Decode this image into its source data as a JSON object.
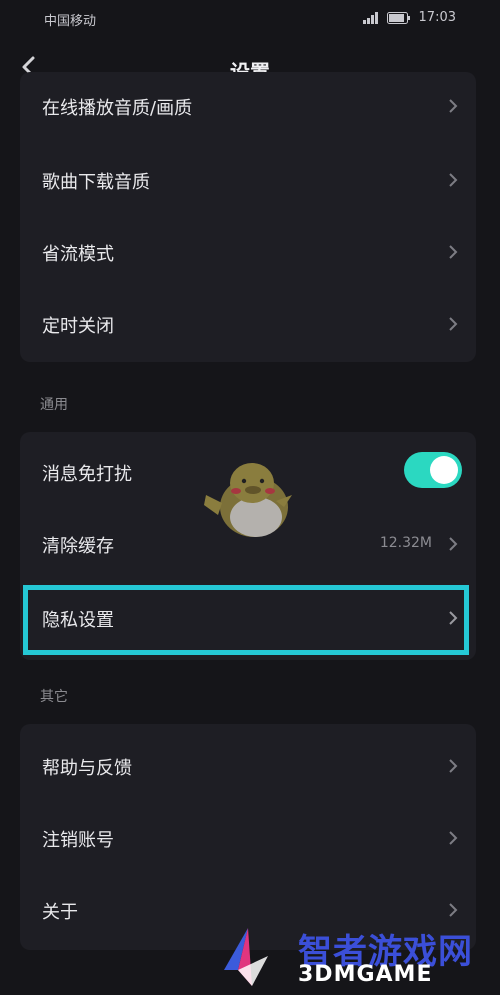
{
  "status_bar": {
    "carrier": "中国移动",
    "time": "17:03",
    "icons": [
      "signal-icon",
      "wifi-icon",
      "battery-icon"
    ]
  },
  "nav": {
    "title": "设置",
    "back_icon": "chevron-left-icon"
  },
  "sections": {
    "playback": {
      "items": [
        {
          "label": "在线播放音质/画质"
        },
        {
          "label": "歌曲下载音质"
        },
        {
          "label": "省流模式"
        },
        {
          "label": "定时关闭"
        }
      ]
    },
    "general": {
      "header": "通用",
      "dnd": {
        "label": "消息免打扰",
        "enabled": true
      },
      "cache": {
        "label": "清除缓存",
        "value": "12.32M"
      },
      "privacy": {
        "label": "隐私设置"
      }
    },
    "other": {
      "header": "其它",
      "items": [
        {
          "label": "帮助与反馈"
        },
        {
          "label": "注销账号"
        },
        {
          "label": "关于"
        }
      ]
    }
  },
  "colors": {
    "background": "#151519",
    "card": "#1e1e24",
    "accent": "#2bd8c1",
    "highlight": "#25c8d5"
  },
  "watermark": {
    "title": "智者游戏网",
    "subtitle": "3DMGAME"
  }
}
